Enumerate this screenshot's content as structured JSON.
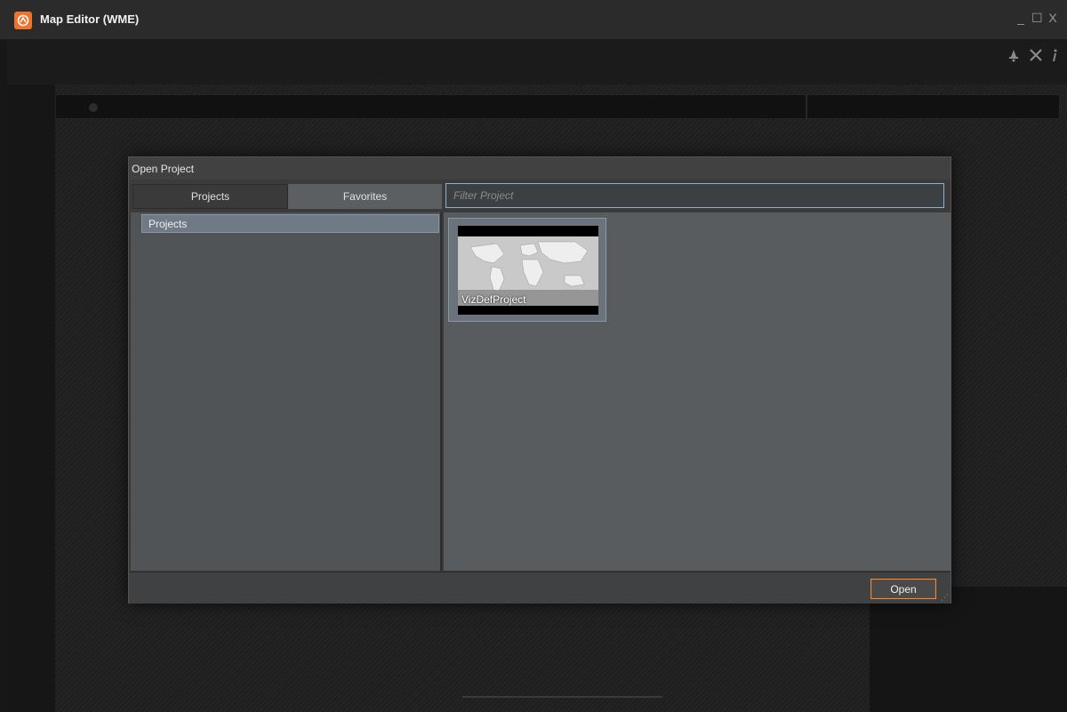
{
  "window": {
    "title": "Map Editor (WME)",
    "controls": {
      "minimize": "_",
      "maximize": "☐",
      "close": "X"
    }
  },
  "toolbar": {
    "icons": [
      "alert-icon",
      "tools-icon",
      "info-icon"
    ]
  },
  "dialog": {
    "title": "Open Project",
    "tabs": [
      {
        "label": "Projects",
        "active": true
      },
      {
        "label": "Favorites",
        "active": false
      }
    ],
    "filter": {
      "placeholder": "Filter Project",
      "value": ""
    },
    "tree": {
      "items": [
        {
          "label": "Projects",
          "selected": true
        }
      ]
    },
    "projects": [
      {
        "name": "VizDefProject"
      }
    ],
    "open_button": "Open"
  },
  "colors": {
    "accent": "#f0732d",
    "selection": "#707a86",
    "focus_border": "#8db0d0"
  }
}
